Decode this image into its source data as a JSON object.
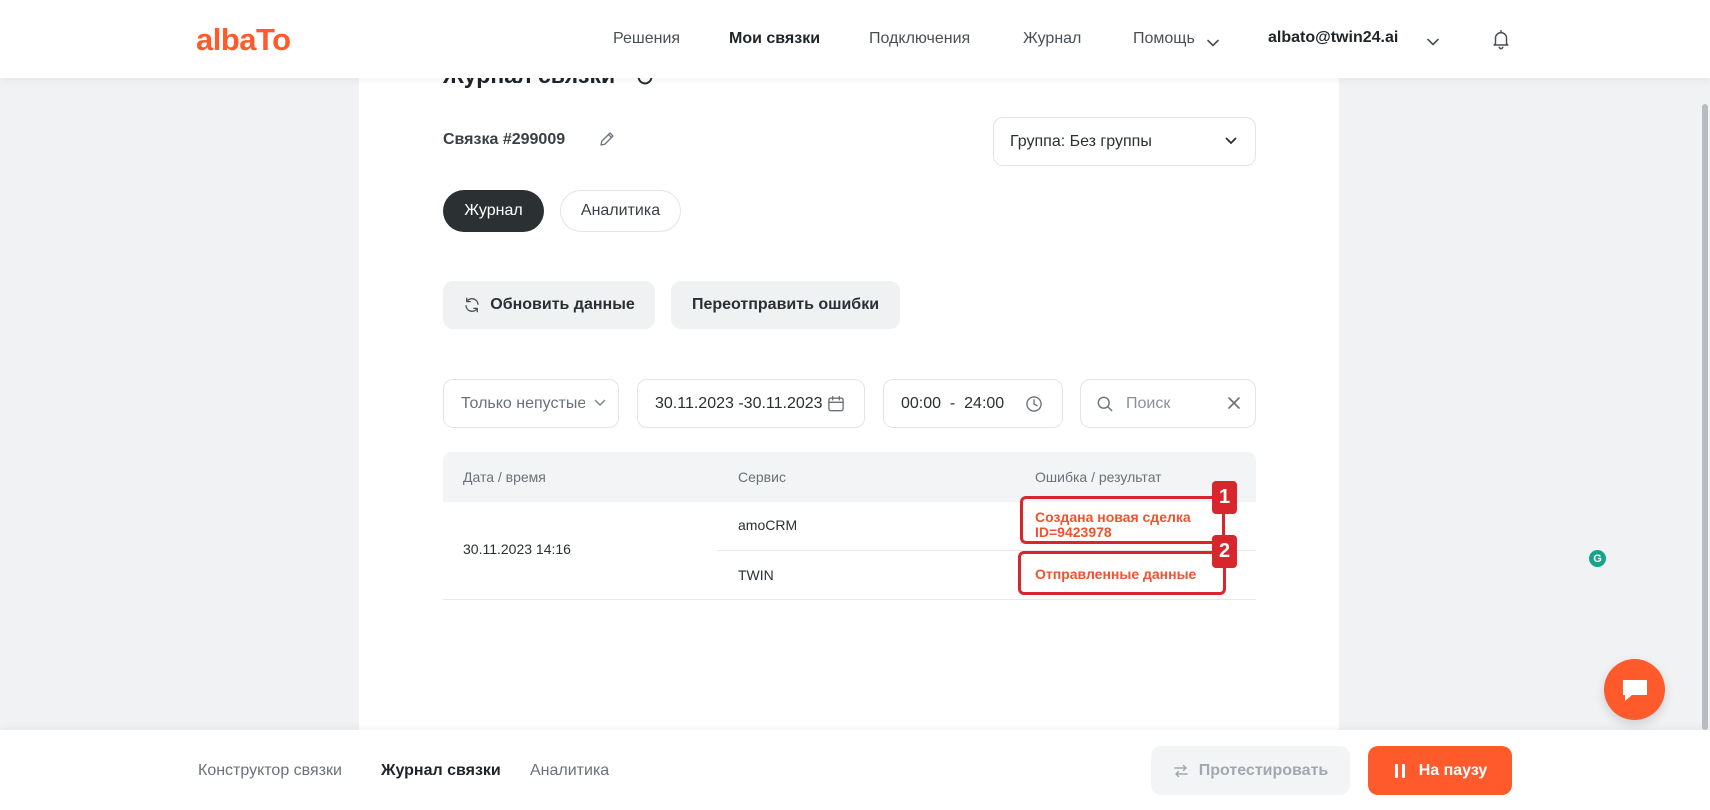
{
  "header": {
    "logo": "albaTo",
    "nav": [
      "Решения",
      "Мои связки",
      "Подключения",
      "Журнал",
      "Помощь"
    ],
    "user_email": "albato@twin24.ai"
  },
  "page": {
    "title": "Журнал связки",
    "link_label": "Связка #299009",
    "group_select": "Группа: Без группы",
    "tabs": [
      "Журнал",
      "Аналитика"
    ],
    "buttons": {
      "refresh": "Обновить данные",
      "resend": "Переотправить ошибки"
    },
    "filters": {
      "empty_only": "Только непустые",
      "date_range": "30.11.2023 -30.11.2023",
      "time_range": "00:00  -  24:00",
      "search_placeholder": "Поиск"
    }
  },
  "table": {
    "columns": [
      "Дата / время",
      "Сервис",
      "Ошибка / результат"
    ],
    "rows": [
      {
        "datetime": "30.11.2023 14:16",
        "entries": [
          {
            "service": "amoCRM",
            "result_line1": "Создана новая сделка",
            "result_line2": "ID=9423978",
            "marker": "1"
          },
          {
            "service": "TWIN",
            "result_line1": "Отправленные данные",
            "marker": "2"
          }
        ]
      }
    ]
  },
  "footer": {
    "tabs": [
      "Конструктор связки",
      "Журнал связки",
      "Аналитика"
    ],
    "test_button": "Протестировать",
    "pause_button": "На паузу"
  },
  "colors": {
    "brand": "#ff5a2c",
    "annotation": "#d9262c",
    "dark_pill": "#2b3133"
  }
}
